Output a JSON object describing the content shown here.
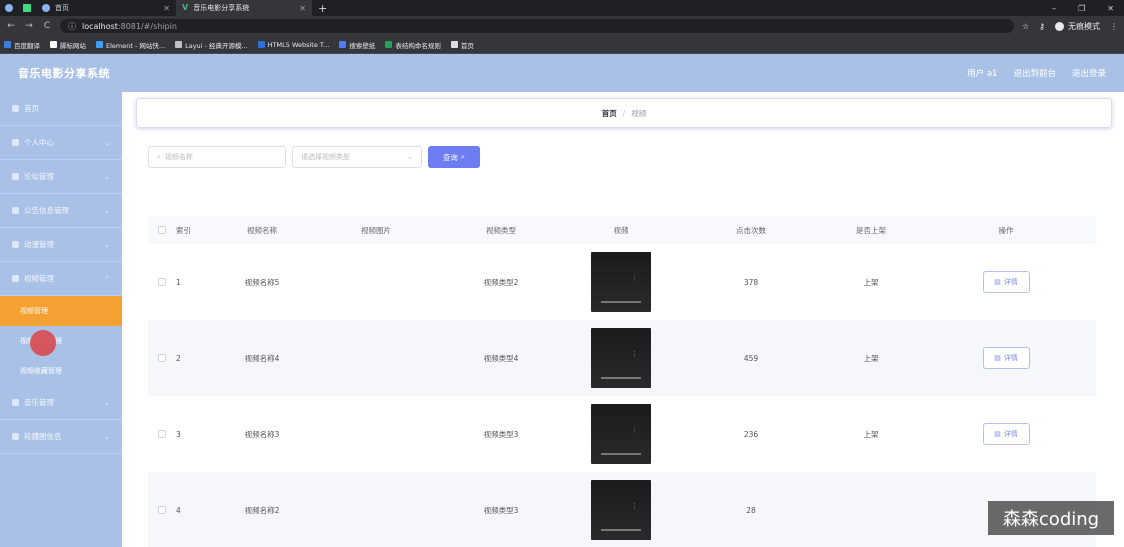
{
  "browser": {
    "tabs": [
      {
        "label": "",
        "icon": "chrome-icon"
      },
      {
        "label": "",
        "icon": "app-icon"
      },
      {
        "label": "首页",
        "icon": "globe-icon"
      },
      {
        "label": "音乐电影分享系统",
        "icon": "vue-icon",
        "active": true
      }
    ],
    "url_host": "localhost",
    "url_rest": ":8081/#/shipin",
    "incognito_label": "无痕模式",
    "bookmarks": [
      {
        "label": "百度翻译",
        "color": "#3b7ddd"
      },
      {
        "label": "脚标网站",
        "color": "#ffffff"
      },
      {
        "label": "Element - 网站快...",
        "color": "#409eff"
      },
      {
        "label": "Layui - 经典开源模...",
        "color": "#c0c0c0"
      },
      {
        "label": "HTML5 Website T...",
        "color": "#2d6fd6"
      },
      {
        "label": "搜索壁纸",
        "color": "#4f7cff"
      },
      {
        "label": "表结构命名规则",
        "color": "#21a35a"
      },
      {
        "label": "首页",
        "color": "#dddddd"
      }
    ]
  },
  "header": {
    "title": "音乐电影分享系统",
    "user": "用户 a1",
    "back_to_front": "退出到前台",
    "logout": "退出登录"
  },
  "sidebar": {
    "items": [
      {
        "label": "首页"
      },
      {
        "label": "个人中心"
      },
      {
        "label": "论坛管理"
      },
      {
        "label": "公告信息管理"
      },
      {
        "label": "动漫管理"
      },
      {
        "label": "视频管理"
      }
    ],
    "sub_items": [
      {
        "label": "视频管理",
        "active": true
      },
      {
        "label": "视频收藏管理"
      },
      {
        "label": "视频收藏管理"
      }
    ],
    "items_after": [
      {
        "label": "音乐管理"
      },
      {
        "label": "轮播图信息"
      }
    ]
  },
  "breadcrumb": {
    "home": "首页",
    "separator": "/",
    "current": "视频"
  },
  "search": {
    "name_placeholder": "视频名称",
    "type_placeholder": "请选择视频类型",
    "query_label": "查询"
  },
  "table": {
    "headers": [
      "索引",
      "视频名称",
      "视频图片",
      "视频类型",
      "视频",
      "点击次数",
      "是否上架",
      "操作"
    ],
    "rows": [
      {
        "index": "1",
        "name": "视频名称5",
        "image": "",
        "type": "视频类型2",
        "clicks": "378",
        "shelf": "上架",
        "action": "详情"
      },
      {
        "index": "2",
        "name": "视频名称4",
        "image": "",
        "type": "视频类型4",
        "clicks": "459",
        "shelf": "上架",
        "action": "详情"
      },
      {
        "index": "3",
        "name": "视频名称3",
        "image": "",
        "type": "视频类型3",
        "clicks": "236",
        "shelf": "上架",
        "action": "详情"
      },
      {
        "index": "4",
        "name": "视频名称2",
        "image": "",
        "type": "视频类型3",
        "clicks": "28",
        "shelf": "",
        "action": ""
      }
    ]
  },
  "watermark": "森森coding",
  "colors": {
    "sidebar": "#a9c1e6",
    "active_menu": "#f5a032",
    "primary": "#6e7cf2"
  }
}
